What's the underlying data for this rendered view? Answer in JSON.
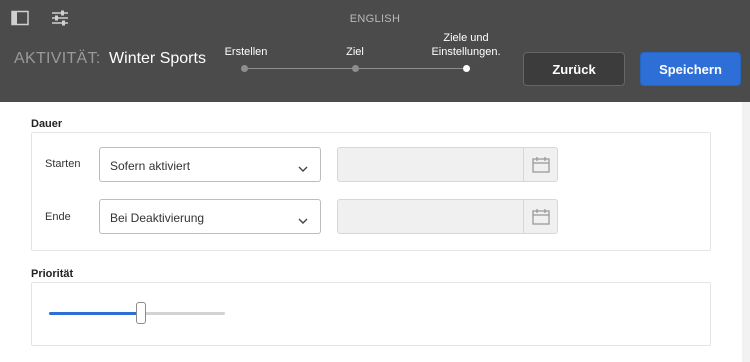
{
  "header": {
    "language": "ENGLISH",
    "activity_label": "AKTIVITÄT:",
    "activity_name": "Winter Sports",
    "icons": [
      "sidebar-toggle-icon",
      "sliders-icon"
    ]
  },
  "steps": [
    {
      "label": "Erstellen",
      "state": "completed"
    },
    {
      "label": "Ziel",
      "state": "completed"
    },
    {
      "label": "Ziele und Einstellungen.",
      "state": "current"
    }
  ],
  "buttons": {
    "back_label": "Zurück",
    "save_label": "Speichern"
  },
  "duration": {
    "title": "Dauer",
    "start": {
      "label": "Starten",
      "option": "Sofern aktiviert",
      "date_value": ""
    },
    "end": {
      "label": "Ende",
      "option": "Bei Deaktivierung",
      "date_value": ""
    }
  },
  "priority": {
    "title": "Priorität",
    "level": 0.5
  },
  "colors": {
    "header_bg": "#4b4b4b",
    "accent": "#2d6fd6"
  }
}
